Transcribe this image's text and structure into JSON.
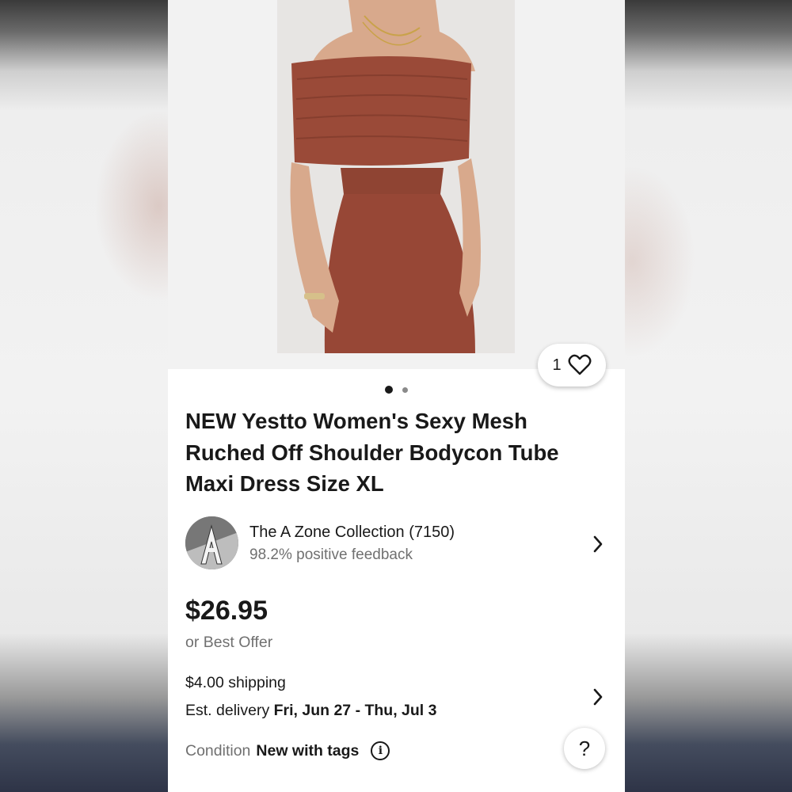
{
  "listing": {
    "title_line1": "NEW Yestto Women's Sexy Mesh",
    "title_line2": "Ruched Off Shoulder Bodycon Tube",
    "title_line3": "Maxi Dress Size XL",
    "image": {
      "icon": "dress-photo",
      "dress_color": "#9a4a38"
    },
    "watch_count": "1",
    "gallery_dots": 2
  },
  "seller": {
    "name": "The A Zone Collection (7150)",
    "feedback": "98.2% positive feedback",
    "avatar_letter": "A"
  },
  "pricing": {
    "price": "$26.95",
    "offer": "or Best Offer"
  },
  "shipping": {
    "cost": "$4.00 shipping",
    "delivery_label": "Est. delivery ",
    "delivery_dates": "Fri, Jun 27 - Thu, Jul 3"
  },
  "condition": {
    "label": "Condition",
    "value": "New with tags"
  },
  "help": {
    "label": "?"
  }
}
